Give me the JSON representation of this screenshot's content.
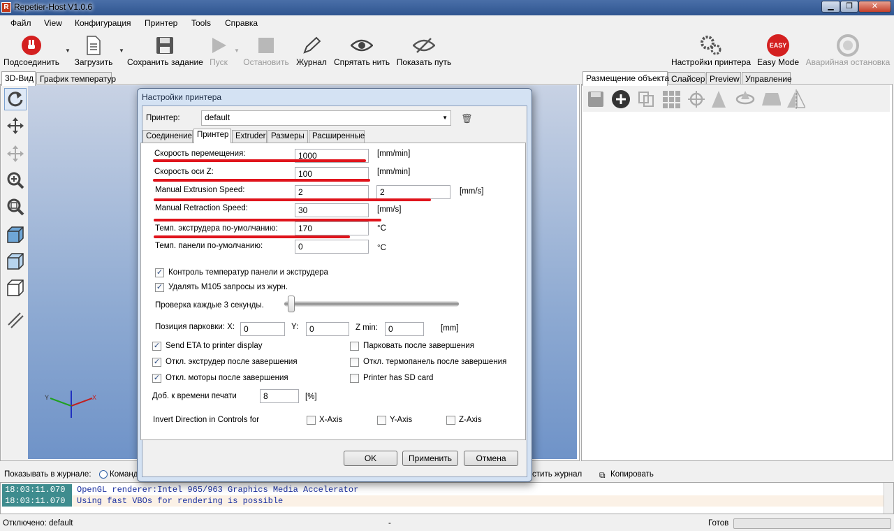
{
  "window": {
    "title": "Repetier-Host V1.0.6",
    "min": "▁",
    "max": "❐",
    "close": "✕"
  },
  "menu": [
    "Файл",
    "View",
    "Конфигурация",
    "Принтер",
    "Tools",
    "Справка"
  ],
  "toolbar": {
    "connect": "Подсоединить",
    "load": "Загрузить",
    "save_job": "Сохранить задание",
    "start": "Пуск",
    "stop": "Остановить",
    "journal": "Журнал",
    "hide_thread": "Спрятать нить",
    "show_path": "Показать путь",
    "printer_settings": "Настройки принтера",
    "easy_mode": "Easy Mode",
    "easy_badge": "EASY",
    "emergency": "Аварийная остановка"
  },
  "left_tabs": [
    "3D-Вид",
    "График температур"
  ],
  "right_tabs": [
    "Размещение объекта",
    "Слайсер",
    "Preview",
    "Управление"
  ],
  "dialog": {
    "title": "Настройки принтера",
    "printer_label": "Принтер:",
    "printer_value": "default",
    "tabs": [
      "Соединение",
      "Принтер",
      "Extruder",
      "Размеры",
      "Расширенные"
    ],
    "travel_speed": {
      "label": "Скорость перемещения:",
      "value": "1000",
      "unit": "[mm/min]"
    },
    "z_speed": {
      "label": "Скорость оси Z:",
      "value": "100",
      "unit": "[mm/min]"
    },
    "extrusion_speed": {
      "label": "Manual Extrusion Speed:",
      "value1": "2",
      "value2": "2",
      "unit": "[mm/s]"
    },
    "retraction_speed": {
      "label": "Manual Retraction Speed:",
      "value": "30",
      "unit": "[mm/s]"
    },
    "extruder_temp": {
      "label": "Темп. экструдера по-умолчанию:",
      "value": "170",
      "unit": "°C"
    },
    "bed_temp": {
      "label": "Темп. панели по-умолчанию:",
      "value": "0",
      "unit": "°C"
    },
    "check_temp": "Контроль температур панели и экструдера",
    "remove_m105": "Удалять M105 запросы из журн.",
    "check_every": "Проверка каждые 3 секунды.",
    "park_label": "Позиция парковки: X:",
    "park_x": "0",
    "park_y_label": "Y:",
    "park_y": "0",
    "park_z_label": "Z min:",
    "park_z": "0",
    "park_unit": "[mm]",
    "send_eta": "Send ETA to printer display",
    "disable_extruder": "Откл. экструдер после завершения",
    "disable_motors": "Откл. моторы после завершения",
    "park_after": "Парковать после завершения",
    "disable_bed": "Откл. термопанель после завершения",
    "sd_card": "Printer has SD card",
    "add_time_label": "Доб. к времени печати",
    "add_time_value": "8",
    "add_time_unit": "[%]",
    "invert_label": "Invert Direction in Controls for",
    "x_axis": "X-Axis",
    "y_axis": "Y-Axis",
    "z_axis": "Z-Axis",
    "ok": "OK",
    "apply": "Применить",
    "cancel": "Отмена"
  },
  "log": {
    "show_label": "Показывать в журнале:",
    "commands_radio": "Команд",
    "clear": "стить журнал",
    "copy": "Копировать",
    "rows": [
      {
        "time": "18:03:11.070",
        "text": "OpenGL renderer:Intel 965/963 Graphics Media Accelerator"
      },
      {
        "time": "18:03:11.070",
        "text": "Using fast VBOs for rendering is possible"
      }
    ]
  },
  "status": {
    "left": "Отключено: default",
    "mid": "-",
    "right": "Готов"
  },
  "colors": {
    "accent_red": "#e0141c",
    "log_ts": "#3e8c8e",
    "viewport": "#8eaad2"
  }
}
